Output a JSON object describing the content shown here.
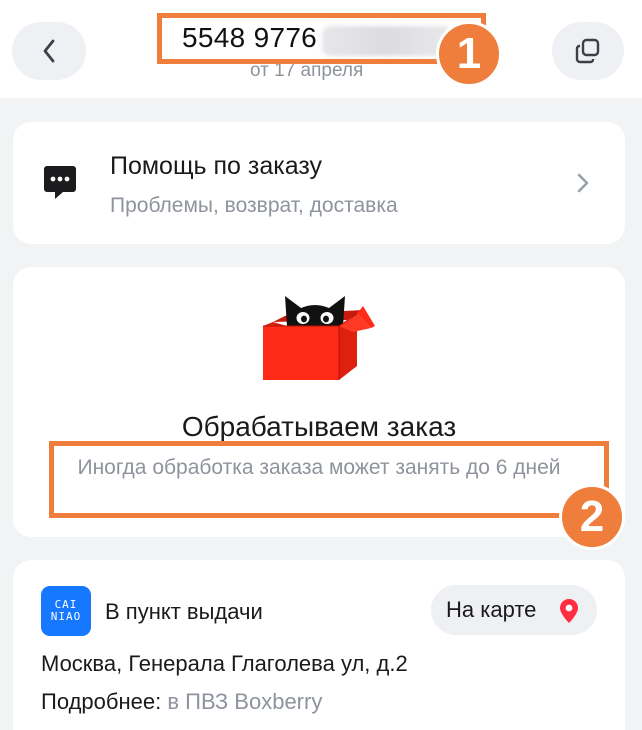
{
  "header": {
    "order_number": "5548 9776",
    "order_date": "от 17 апреля",
    "back_icon": "chevron-left-icon",
    "copy_icon": "copy-icon"
  },
  "annotations": {
    "marker_1": "1",
    "marker_2": "2",
    "color": "#ef7d3c"
  },
  "help": {
    "title": "Помощь по заказу",
    "subtitle": "Проблемы, возврат, доставка",
    "icon": "chat-bubble-icon",
    "chevron_icon": "chevron-right-icon"
  },
  "status": {
    "title": "Обрабатываем заказ",
    "description": "Иногда обработка заказа может занять до 6 дней",
    "illustration": "cat-in-box-icon",
    "box_color": "#ff2a17"
  },
  "delivery": {
    "logo_text": "CAI\nNIAO",
    "logo_color": "#1677ff",
    "type": "В пункт выдачи",
    "map_button": "На карте",
    "map_icon": "map-pin-icon",
    "address": "Москва, Генерала Глаголева ул, д.2",
    "details_label": "Подробнее:",
    "details_link": "в ПВЗ Boxberry"
  }
}
